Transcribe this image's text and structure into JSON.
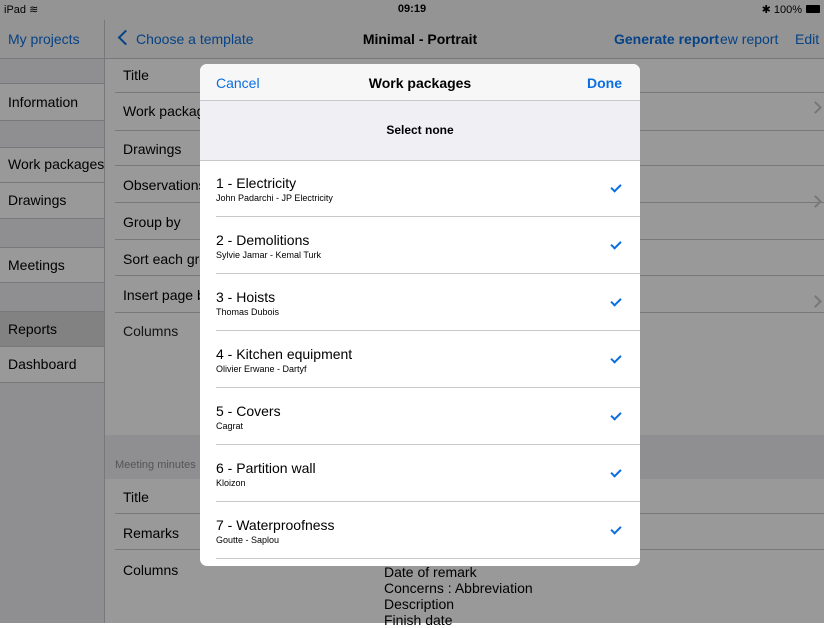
{
  "status_bar": {
    "device": "iPad",
    "wifi_icon": "wifi-icon",
    "time": "09:19",
    "battery": "100%"
  },
  "navbar": {
    "my_projects": "My projects",
    "choose_template": "Choose a template",
    "title": "Minimal - Portrait",
    "generate_report": "Generate report",
    "new_report": "ew report",
    "edit": "Edit"
  },
  "sidebar": {
    "items": [
      {
        "label": "Information"
      },
      {
        "label": "Work packages"
      },
      {
        "label": "Drawings"
      },
      {
        "label": "Meetings"
      },
      {
        "label": "Reports"
      },
      {
        "label": "Dashboard"
      }
    ]
  },
  "content": {
    "rows": [
      {
        "label": "Title"
      },
      {
        "label": "Work packages"
      },
      {
        "label": "Drawings"
      },
      {
        "label": "Observations"
      },
      {
        "label": "Group by"
      },
      {
        "label": "Sort each group"
      },
      {
        "label": "Insert page break"
      },
      {
        "label": "Columns"
      }
    ],
    "section_header": "Meeting minutes",
    "rows2": [
      {
        "label": "Title"
      },
      {
        "label": "Remarks"
      },
      {
        "label": "Columns"
      }
    ],
    "columns_list": [
      "Date of remark",
      "Concerns : Abbreviation",
      "Description",
      "Finish date"
    ]
  },
  "modal": {
    "cancel": "Cancel",
    "title": "Work packages",
    "done": "Done",
    "select_none": "Select none",
    "items": [
      {
        "title": "1 - Electricity",
        "subtitle": "John Padarchi - JP Electricity"
      },
      {
        "title": "2 - Demolitions",
        "subtitle": "Sylvie Jamar - Kemal Turk"
      },
      {
        "title": "3 - Hoists",
        "subtitle": "Thomas Dubois"
      },
      {
        "title": "4 - Kitchen equipment",
        "subtitle": "Olivier Erwane - Dartyf"
      },
      {
        "title": "5 - Covers",
        "subtitle": "Cagrat"
      },
      {
        "title": "6 - Partition wall",
        "subtitle": "Kloizon"
      },
      {
        "title": "7 - Waterproofness",
        "subtitle": "Goutte - Saplou"
      }
    ],
    "check_icon": "checkmark-icon",
    "accent_color": "#0a6fe0"
  }
}
